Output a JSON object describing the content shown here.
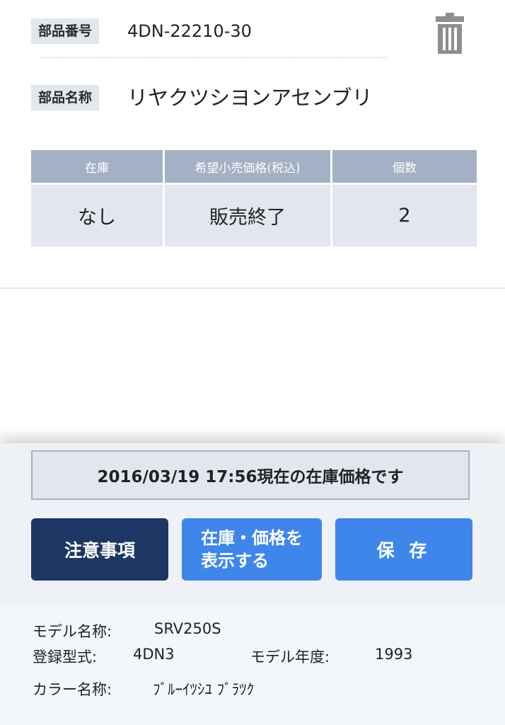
{
  "part": {
    "number_label": "部品番号",
    "number_value": "4DN-22210-30",
    "name_label": "部品名称",
    "name_value": "リヤクツシヨンアセンブリ"
  },
  "table": {
    "headers": [
      "在庫",
      "希望小売価格(税込)",
      "個数"
    ],
    "row": [
      "なし",
      "販売終了",
      "2"
    ]
  },
  "notice": "2016/03/19 17:56現在の在庫価格です",
  "buttons": {
    "notes": "注意事項",
    "show_stock_line1": "在庫・価格を",
    "show_stock_line2": "表示する",
    "save": "保 存"
  },
  "model": {
    "name_label": "モデル名称:",
    "name_value": "SRV250S",
    "reg_label": "登録型式:",
    "reg_value": "4DN3",
    "year_label": "モデル年度:",
    "year_value": "1993",
    "color_label": "カラー名称:",
    "color_value": "ﾌﾞﾙｰｲﾂｼﾕ ﾌﾞﾗﾂｸ"
  },
  "colors": {
    "navy_button": "#1e3663",
    "blue_button": "#3f86ea",
    "header_cell": "#a4b0c3",
    "light_cell": "#e1e6ef"
  },
  "icons": [
    "trash-icon"
  ]
}
